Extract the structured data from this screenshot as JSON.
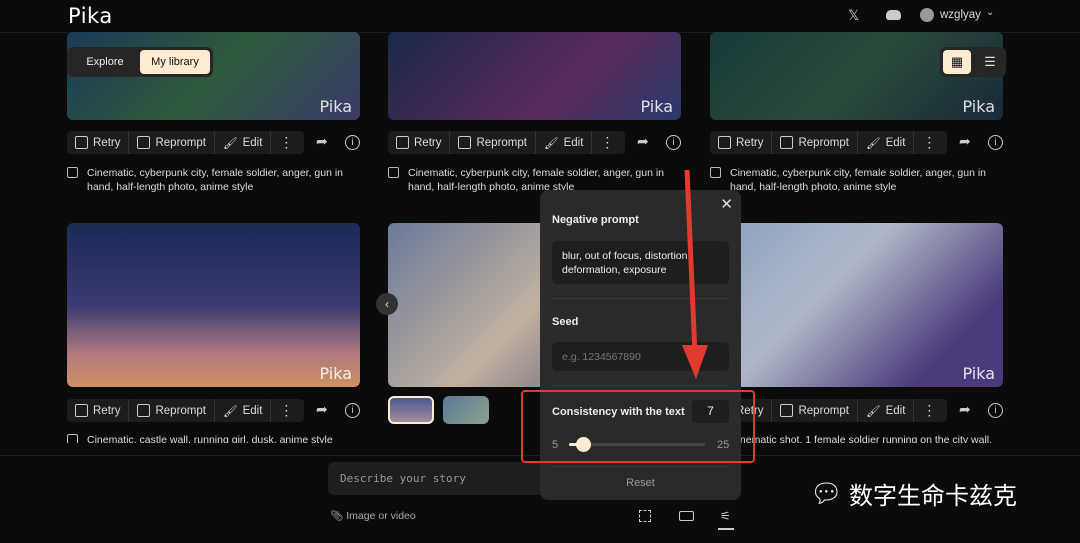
{
  "app": {
    "logo": "Pika",
    "username": "wzglyay"
  },
  "tabs": [
    {
      "label": "Explore",
      "active": false
    },
    {
      "label": "My library",
      "active": true
    }
  ],
  "view_toggle": {
    "active": "grid"
  },
  "toolbar": {
    "retry": "Retry",
    "reprompt": "Reprompt",
    "edit": "Edit"
  },
  "watermark": "Pika",
  "cards": [
    {
      "caption": "Cinematic, cyberpunk city, female soldier, anger, gun in hand, half-length photo, anime style"
    },
    {
      "caption": "Cinematic, cyberpunk city, female soldier, anger, gun in hand, half-length photo, anime style"
    },
    {
      "caption": "Cinematic, cyberpunk city, female soldier, anger, gun in hand, half-length photo, anime style"
    },
    {
      "caption": "Cinematic, castle wall, running girl, dusk, anime style"
    },
    {
      "caption": ""
    },
    {
      "caption": "Cinematic shot, 1 female soldier running on the city wall,"
    }
  ],
  "popover": {
    "negative_prompt_label": "Negative prompt",
    "negative_prompt_value": "blur, out of focus, distortion, deformation, exposure",
    "seed_label": "Seed",
    "seed_placeholder": "e.g. 1234567890",
    "consistency_label": "Consistency with the text",
    "consistency_value": "7",
    "slider_min": "5",
    "slider_max": "25",
    "slider_value": 7,
    "reset": "Reset"
  },
  "prompt": {
    "placeholder": "Describe your story",
    "attach": "Image or video"
  },
  "watermark_overlay": "数字生命卡兹克",
  "colors": {
    "accent": "#fdecd2",
    "annotation": "#e23a2e"
  }
}
